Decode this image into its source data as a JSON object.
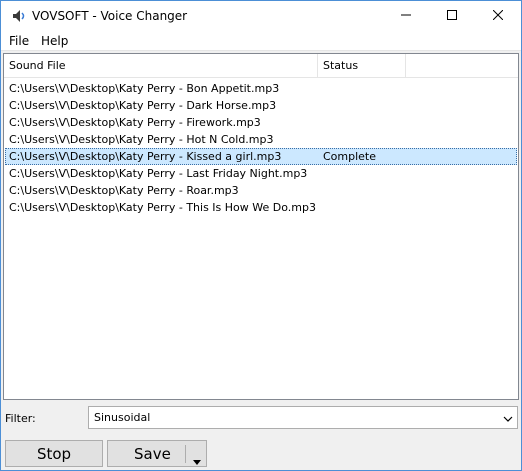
{
  "window": {
    "title": "VOVSOFT - Voice Changer"
  },
  "menu": {
    "file": "File",
    "help": "Help"
  },
  "list": {
    "columns": {
      "sound_file": "Sound File",
      "status": "Status"
    },
    "rows": [
      {
        "file": "C:\\Users\\V\\Desktop\\Katy Perry - Bon Appetit.mp3",
        "status": ""
      },
      {
        "file": "C:\\Users\\V\\Desktop\\Katy Perry - Dark Horse.mp3",
        "status": ""
      },
      {
        "file": "C:\\Users\\V\\Desktop\\Katy Perry - Firework.mp3",
        "status": ""
      },
      {
        "file": "C:\\Users\\V\\Desktop\\Katy Perry - Hot N Cold.mp3",
        "status": ""
      },
      {
        "file": "C:\\Users\\V\\Desktop\\Katy Perry - Kissed a girl.mp3",
        "status": "Complete",
        "selected": true
      },
      {
        "file": "C:\\Users\\V\\Desktop\\Katy Perry - Last Friday Night.mp3",
        "status": ""
      },
      {
        "file": "C:\\Users\\V\\Desktop\\Katy Perry - Roar.mp3",
        "status": ""
      },
      {
        "file": "C:\\Users\\V\\Desktop\\Katy Perry - This Is How We Do.mp3",
        "status": ""
      }
    ]
  },
  "filter": {
    "label": "Filter:",
    "value": "Sinusoidal"
  },
  "buttons": {
    "stop": "Stop",
    "save": "Save"
  },
  "icons": {
    "app": "speaker-icon",
    "minimize": "minimize-icon",
    "maximize": "maximize-icon",
    "close": "close-icon",
    "dropdown": "chevron-down-icon",
    "save_menu": "triangle-down-icon"
  },
  "colors": {
    "selection_bg": "#cce8ff",
    "window_border": "#4c8fd6",
    "button_bg": "#e1e1e1"
  }
}
